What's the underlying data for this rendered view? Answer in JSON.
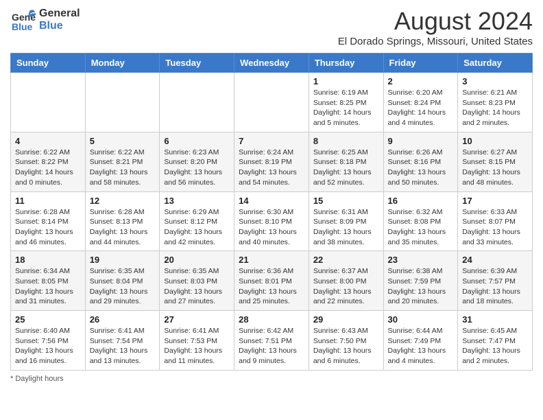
{
  "logo": {
    "general": "General",
    "blue": "Blue"
  },
  "title": "August 2024",
  "subtitle": "El Dorado Springs, Missouri, United States",
  "weekdays": [
    "Sunday",
    "Monday",
    "Tuesday",
    "Wednesday",
    "Thursday",
    "Friday",
    "Saturday"
  ],
  "weeks": [
    [
      {
        "day": "",
        "info": ""
      },
      {
        "day": "",
        "info": ""
      },
      {
        "day": "",
        "info": ""
      },
      {
        "day": "",
        "info": ""
      },
      {
        "day": "1",
        "info": "Sunrise: 6:19 AM\nSunset: 8:25 PM\nDaylight: 14 hours and 5 minutes."
      },
      {
        "day": "2",
        "info": "Sunrise: 6:20 AM\nSunset: 8:24 PM\nDaylight: 14 hours and 4 minutes."
      },
      {
        "day": "3",
        "info": "Sunrise: 6:21 AM\nSunset: 8:23 PM\nDaylight: 14 hours and 2 minutes."
      }
    ],
    [
      {
        "day": "4",
        "info": "Sunrise: 6:22 AM\nSunset: 8:22 PM\nDaylight: 14 hours and 0 minutes."
      },
      {
        "day": "5",
        "info": "Sunrise: 6:22 AM\nSunset: 8:21 PM\nDaylight: 13 hours and 58 minutes."
      },
      {
        "day": "6",
        "info": "Sunrise: 6:23 AM\nSunset: 8:20 PM\nDaylight: 13 hours and 56 minutes."
      },
      {
        "day": "7",
        "info": "Sunrise: 6:24 AM\nSunset: 8:19 PM\nDaylight: 13 hours and 54 minutes."
      },
      {
        "day": "8",
        "info": "Sunrise: 6:25 AM\nSunset: 8:18 PM\nDaylight: 13 hours and 52 minutes."
      },
      {
        "day": "9",
        "info": "Sunrise: 6:26 AM\nSunset: 8:16 PM\nDaylight: 13 hours and 50 minutes."
      },
      {
        "day": "10",
        "info": "Sunrise: 6:27 AM\nSunset: 8:15 PM\nDaylight: 13 hours and 48 minutes."
      }
    ],
    [
      {
        "day": "11",
        "info": "Sunrise: 6:28 AM\nSunset: 8:14 PM\nDaylight: 13 hours and 46 minutes."
      },
      {
        "day": "12",
        "info": "Sunrise: 6:28 AM\nSunset: 8:13 PM\nDaylight: 13 hours and 44 minutes."
      },
      {
        "day": "13",
        "info": "Sunrise: 6:29 AM\nSunset: 8:12 PM\nDaylight: 13 hours and 42 minutes."
      },
      {
        "day": "14",
        "info": "Sunrise: 6:30 AM\nSunset: 8:10 PM\nDaylight: 13 hours and 40 minutes."
      },
      {
        "day": "15",
        "info": "Sunrise: 6:31 AM\nSunset: 8:09 PM\nDaylight: 13 hours and 38 minutes."
      },
      {
        "day": "16",
        "info": "Sunrise: 6:32 AM\nSunset: 8:08 PM\nDaylight: 13 hours and 35 minutes."
      },
      {
        "day": "17",
        "info": "Sunrise: 6:33 AM\nSunset: 8:07 PM\nDaylight: 13 hours and 33 minutes."
      }
    ],
    [
      {
        "day": "18",
        "info": "Sunrise: 6:34 AM\nSunset: 8:05 PM\nDaylight: 13 hours and 31 minutes."
      },
      {
        "day": "19",
        "info": "Sunrise: 6:35 AM\nSunset: 8:04 PM\nDaylight: 13 hours and 29 minutes."
      },
      {
        "day": "20",
        "info": "Sunrise: 6:35 AM\nSunset: 8:03 PM\nDaylight: 13 hours and 27 minutes."
      },
      {
        "day": "21",
        "info": "Sunrise: 6:36 AM\nSunset: 8:01 PM\nDaylight: 13 hours and 25 minutes."
      },
      {
        "day": "22",
        "info": "Sunrise: 6:37 AM\nSunset: 8:00 PM\nDaylight: 13 hours and 22 minutes."
      },
      {
        "day": "23",
        "info": "Sunrise: 6:38 AM\nSunset: 7:59 PM\nDaylight: 13 hours and 20 minutes."
      },
      {
        "day": "24",
        "info": "Sunrise: 6:39 AM\nSunset: 7:57 PM\nDaylight: 13 hours and 18 minutes."
      }
    ],
    [
      {
        "day": "25",
        "info": "Sunrise: 6:40 AM\nSunset: 7:56 PM\nDaylight: 13 hours and 16 minutes."
      },
      {
        "day": "26",
        "info": "Sunrise: 6:41 AM\nSunset: 7:54 PM\nDaylight: 13 hours and 13 minutes."
      },
      {
        "day": "27",
        "info": "Sunrise: 6:41 AM\nSunset: 7:53 PM\nDaylight: 13 hours and 11 minutes."
      },
      {
        "day": "28",
        "info": "Sunrise: 6:42 AM\nSunset: 7:51 PM\nDaylight: 13 hours and 9 minutes."
      },
      {
        "day": "29",
        "info": "Sunrise: 6:43 AM\nSunset: 7:50 PM\nDaylight: 13 hours and 6 minutes."
      },
      {
        "day": "30",
        "info": "Sunrise: 6:44 AM\nSunset: 7:49 PM\nDaylight: 13 hours and 4 minutes."
      },
      {
        "day": "31",
        "info": "Sunrise: 6:45 AM\nSunset: 7:47 PM\nDaylight: 13 hours and 2 minutes."
      }
    ]
  ],
  "footer": "Daylight hours"
}
